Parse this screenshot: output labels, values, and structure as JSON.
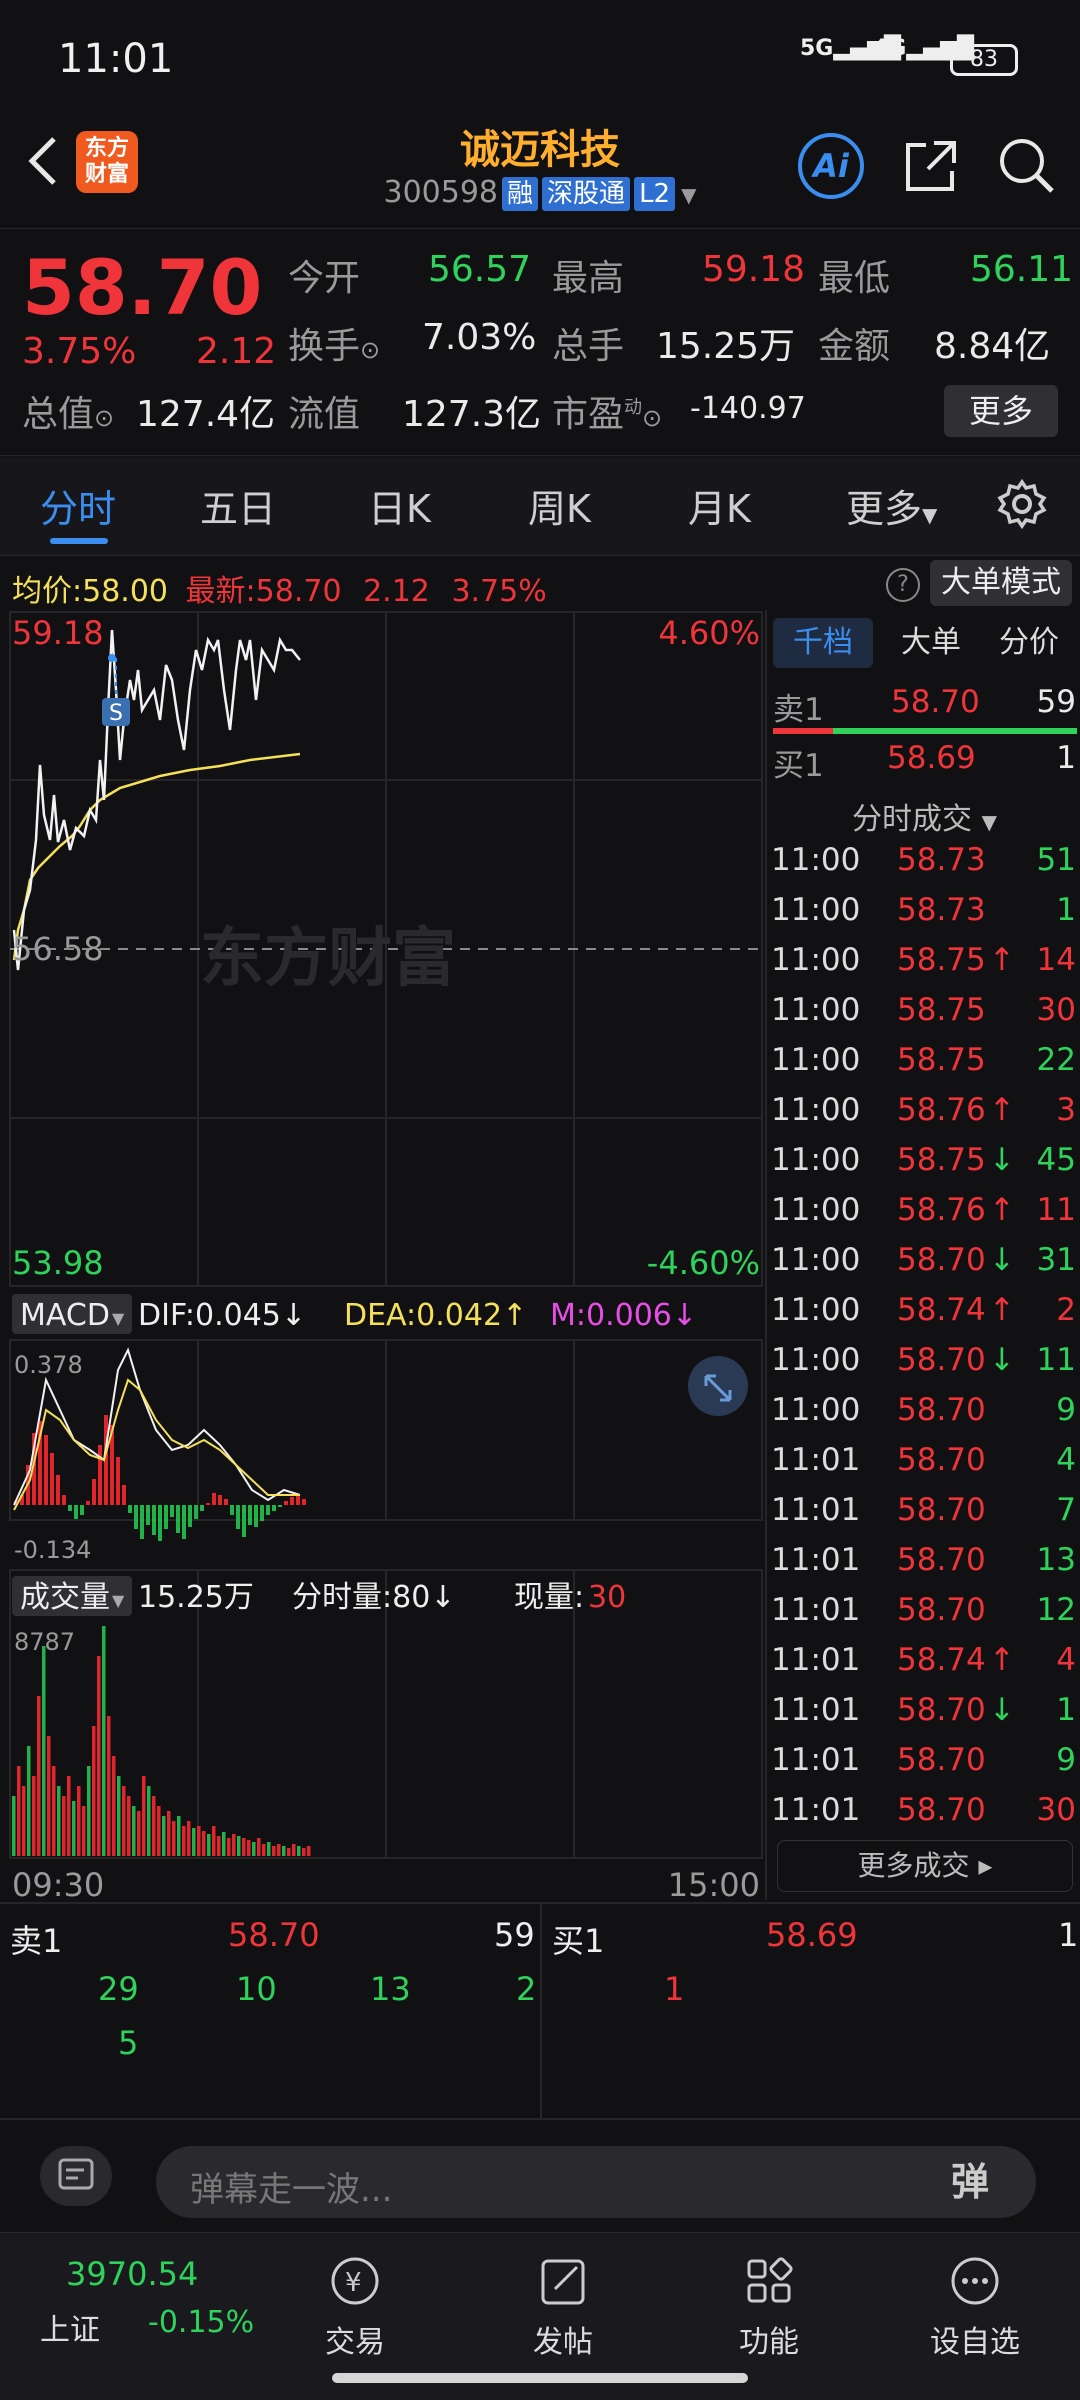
{
  "status_bar": {
    "time": "11:01",
    "signal1": "5G",
    "signal2": "4G",
    "battery": "83"
  },
  "header": {
    "title": "诚迈科技",
    "code": "300598",
    "badges": [
      "融",
      "深股通",
      "L2"
    ],
    "logo_text": "东方财富"
  },
  "quote": {
    "price": "58.70",
    "pct": "3.75%",
    "chg": "2.12",
    "row1": [
      {
        "label": "今开",
        "value": "56.57"
      },
      {
        "label": "最高",
        "value": "59.18"
      },
      {
        "label": "最低",
        "value": "56.11"
      }
    ],
    "row2": [
      {
        "label": "换手",
        "value": "7.03%"
      },
      {
        "label": "总手",
        "value": "15.25万"
      },
      {
        "label": "金额",
        "value": "8.84亿"
      }
    ],
    "row3": [
      {
        "label": "总值",
        "value": "127.4亿"
      },
      {
        "label": "流值",
        "value": "127.3亿"
      },
      {
        "label": "市盈",
        "value": "-140.97",
        "sup": "动"
      }
    ],
    "more_button": "更多"
  },
  "tabs": [
    "分时",
    "五日",
    "日K",
    "周K",
    "月K",
    "更多"
  ],
  "avg_bar": {
    "avg_label": "均价:",
    "avg_value": "58.00",
    "latest_label": "最新:",
    "latest_value": "58.70",
    "chg": "2.12",
    "pct": "3.75%",
    "mode_button": "大单模式"
  },
  "price_chart": {
    "top_price": "59.18",
    "mid_price": "56.58",
    "bottom_price": "53.98",
    "top_pct": "4.60%",
    "bottom_pct": "-4.60%",
    "watermark": "东方财富",
    "marker": "S"
  },
  "macd": {
    "selector": "MACD",
    "dif": "DIF:0.045↓",
    "dea": "DEA:0.042↑",
    "m": "M:0.006↓",
    "top": "0.378",
    "bottom": "-0.134"
  },
  "volume": {
    "selector": "成交量",
    "total": "15.25万",
    "period_label": "分时量:80↓",
    "now_label": "现量:",
    "now_value": "30",
    "top": "8787",
    "start_time": "09:30",
    "end_time": "15:00"
  },
  "right_panel": {
    "tabs": [
      "千档",
      "大单",
      "分价"
    ],
    "sell1": {
      "label": "卖1",
      "price": "58.70",
      "qty": "59"
    },
    "buy1": {
      "label": "买1",
      "price": "58.69",
      "qty": "1"
    },
    "trades_header": "分时成交",
    "trades": [
      {
        "t": "11:00",
        "p": "58.73",
        "a": "",
        "q": "51",
        "qc": "green"
      },
      {
        "t": "11:00",
        "p": "58.73",
        "a": "",
        "q": "1",
        "qc": "green"
      },
      {
        "t": "11:00",
        "p": "58.75",
        "a": "↑",
        "q": "14",
        "qc": "red"
      },
      {
        "t": "11:00",
        "p": "58.75",
        "a": "",
        "q": "30",
        "qc": "red"
      },
      {
        "t": "11:00",
        "p": "58.75",
        "a": "",
        "q": "22",
        "qc": "green"
      },
      {
        "t": "11:00",
        "p": "58.76",
        "a": "↑",
        "q": "3",
        "qc": "red"
      },
      {
        "t": "11:00",
        "p": "58.75",
        "a": "↓",
        "q": "45",
        "qc": "green"
      },
      {
        "t": "11:00",
        "p": "58.76",
        "a": "↑",
        "q": "11",
        "qc": "red"
      },
      {
        "t": "11:00",
        "p": "58.70",
        "a": "↓",
        "q": "31",
        "qc": "green"
      },
      {
        "t": "11:00",
        "p": "58.74",
        "a": "↑",
        "q": "2",
        "qc": "red"
      },
      {
        "t": "11:00",
        "p": "58.70",
        "a": "↓",
        "q": "11",
        "qc": "green"
      },
      {
        "t": "11:00",
        "p": "58.70",
        "a": "",
        "q": "9",
        "qc": "green"
      },
      {
        "t": "11:01",
        "p": "58.70",
        "a": "",
        "q": "4",
        "qc": "green"
      },
      {
        "t": "11:01",
        "p": "58.70",
        "a": "",
        "q": "7",
        "qc": "green"
      },
      {
        "t": "11:01",
        "p": "58.70",
        "a": "",
        "q": "13",
        "qc": "green"
      },
      {
        "t": "11:01",
        "p": "58.70",
        "a": "",
        "q": "12",
        "qc": "green"
      },
      {
        "t": "11:01",
        "p": "58.74",
        "a": "↑",
        "q": "4",
        "qc": "red"
      },
      {
        "t": "11:01",
        "p": "58.70",
        "a": "↓",
        "q": "1",
        "qc": "green"
      },
      {
        "t": "11:01",
        "p": "58.70",
        "a": "",
        "q": "9",
        "qc": "green"
      },
      {
        "t": "11:01",
        "p": "58.70",
        "a": "",
        "q": "30",
        "qc": "red"
      }
    ],
    "more_trades": "更多成交"
  },
  "order_book": {
    "sell_label": "卖1",
    "sell_price": "58.70",
    "sell_qty": "59",
    "buy_label": "买1",
    "buy_price": "58.69",
    "buy_qty": "1",
    "sell_queue": [
      "29",
      "10",
      "13",
      "2",
      "5"
    ],
    "buy_queue": [
      "1"
    ]
  },
  "danmu": {
    "placeholder": "弹幕走一波...",
    "send_icon": "弹"
  },
  "bottom_nav": {
    "index_value": "3970.54",
    "index_name": "上证",
    "index_pct": "-0.15%",
    "items": [
      "交易",
      "发帖",
      "功能",
      "设自选"
    ]
  },
  "colors": {
    "up": "#f0353a",
    "down": "#2fd25b",
    "accent": "#3a8ef0",
    "title": "#ffae2e"
  }
}
